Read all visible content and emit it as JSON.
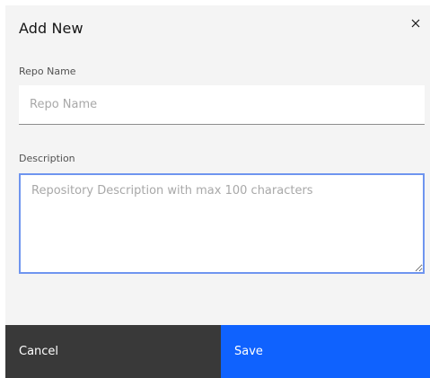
{
  "modal": {
    "title": "Add New",
    "close_icon": "close-icon"
  },
  "repo_name": {
    "label": "Repo Name",
    "placeholder": "Repo Name",
    "value": ""
  },
  "description": {
    "label": "Description",
    "placeholder": "Repository Description with max 100 characters",
    "value": ""
  },
  "footer": {
    "cancel_label": "Cancel",
    "save_label": "Save"
  },
  "colors": {
    "modal_background": "#f4f4f4",
    "cancel_background": "#393939",
    "save_background": "#0f62fe",
    "focus_border": "#6f95ef"
  }
}
